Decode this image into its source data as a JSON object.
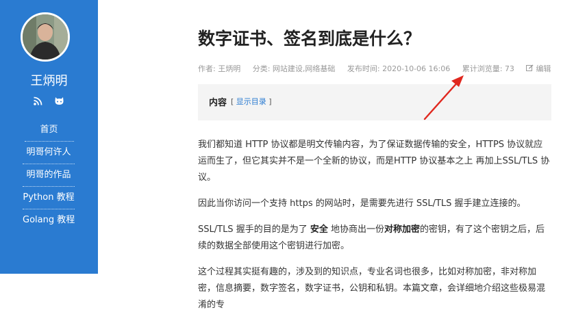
{
  "author": {
    "name": "王炳明"
  },
  "sidebar": {
    "social": [
      {
        "icon": "rss-icon"
      },
      {
        "icon": "github-icon"
      }
    ],
    "items": [
      {
        "label": "首页"
      },
      {
        "label": "明哥何许人"
      },
      {
        "label": "明哥的作品"
      },
      {
        "label": "Python 教程"
      },
      {
        "label": "Golang 教程"
      }
    ]
  },
  "post": {
    "title": "数字证书、签名到底是什么？",
    "meta": {
      "author": "作者: 王炳明",
      "category": "分类: 网站建设,网络基础",
      "published": "发布时间: 2020-10-06 16:06",
      "views": "累计浏览量: 73",
      "edit": "编辑"
    },
    "toc": {
      "title": "内容",
      "toggle": "显示目录",
      "bracket_open": "[",
      "bracket_close": "]"
    },
    "paragraphs": {
      "p1": "我们都知道 HTTP 协议都是明文传输内容，为了保证数据传输的安全，HTTPS 协议就应运而生了，但它其实并不是一个全新的协议，而是HTTP 协议基本之上 再加上SSL/TLS 协议。",
      "p2": "因此当你访问一个支持 https 的网站时，是需要先进行 SSL/TLS 握手建立连接的。",
      "p3a": "SSL/TLS 握手的目的是为了 ",
      "p3b": "安全",
      "p3c": " 地协商出一份",
      "p3d": "对称加密",
      "p3e": "的密钥，有了这个密钥之后，后续的数据全部使用这个密钥进行加密。",
      "p4": "这个过程其实挺有趣的，涉及到的知识点，专业名词也很多，比如对称加密，非对称加密，信息摘要，数字签名，数字证书，公钥和私钥。本篇文章，会详细地介绍这些极易混淆的专"
    }
  },
  "colors": {
    "sidebar_bg": "#2a7bd1",
    "link": "#2a7bd1",
    "annotation_arrow": "#e0281f"
  }
}
